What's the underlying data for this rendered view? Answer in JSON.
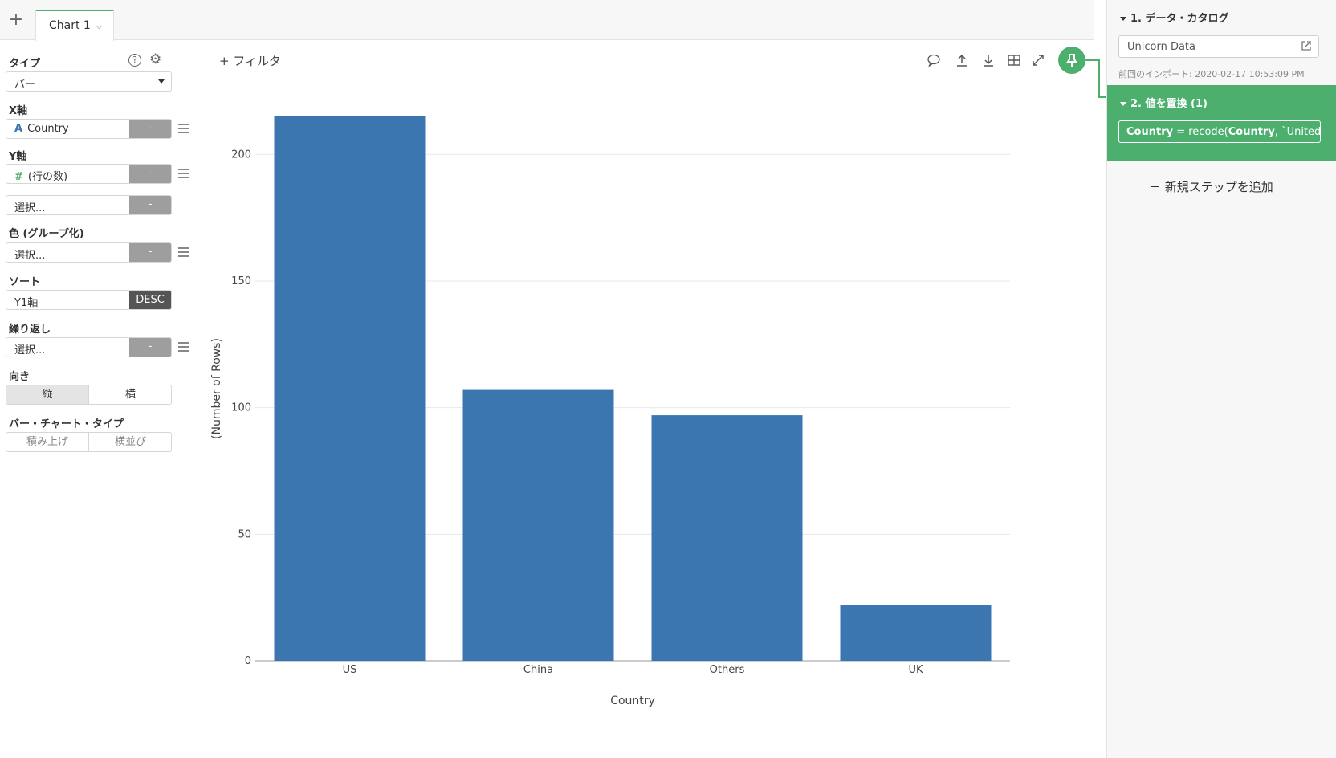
{
  "tabs": {
    "add_symbol": "+",
    "chart_tab_label": "Chart 1",
    "chart_tab_chevron": "⌵"
  },
  "config": {
    "type": {
      "label": "タイプ",
      "value": "バー"
    },
    "x_axis": {
      "label": "X軸",
      "field_icon": "A",
      "value": "Country",
      "btn": "-"
    },
    "y_axis": {
      "label": "Y軸",
      "field_icon": "#",
      "value": "(行の数)",
      "btn": "-"
    },
    "y_axis2": {
      "value": "選択...",
      "btn": "-"
    },
    "color": {
      "label": "色 (グループ化)",
      "value": "選択...",
      "btn": "-"
    },
    "sort": {
      "label": "ソート",
      "value": "Y1軸",
      "btn": "DESC"
    },
    "repeat": {
      "label": "繰り返し",
      "value": "選択...",
      "btn": "-"
    },
    "orientation": {
      "label": "向き",
      "options": [
        "縦",
        "横"
      ],
      "selected": "縦"
    },
    "bar_type": {
      "label": "バー・チャート・タイプ",
      "options": [
        "積み上げ",
        "横並び"
      ]
    }
  },
  "filter_label": "+ フィルタ",
  "icons": {
    "help": "help-icon",
    "settings": "gear-icon",
    "comment": "comment-icon",
    "upload": "upload-icon",
    "download": "download-icon",
    "table": "table-icon",
    "expand": "expand-icon",
    "pin": "pin-icon",
    "external": "external-link-icon"
  },
  "colors": {
    "accent": "#4caf6e",
    "bar": "#3b76b0"
  },
  "chart_data": {
    "type": "bar",
    "categories": [
      "US",
      "China",
      "Others",
      "UK"
    ],
    "values": [
      215,
      107,
      97,
      22
    ],
    "xlabel": "Country",
    "ylabel": "(Number of Rows)",
    "ylim": [
      0,
      215
    ],
    "yticks": [
      0,
      50,
      100,
      150,
      200
    ],
    "grid": true
  },
  "pipeline": {
    "step1_title": "1. データ・カタログ",
    "catalog_name": "Unicorn Data",
    "last_import": "前回のインポート: 2020-02-17 10:53:09 PM",
    "step2_title": "2. 値を置換 (1)",
    "step2_expr_field": "Country",
    "step2_expr_eq": " = recode(",
    "step2_expr_arg": "Country",
    "step2_expr_rest": ", `United ...",
    "add_step": "＋  新規ステップを追加"
  }
}
